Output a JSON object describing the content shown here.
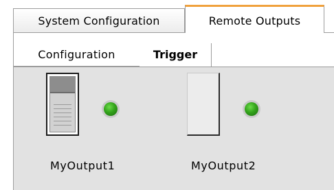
{
  "outer_tabs": [
    {
      "label": "System Configuration",
      "active": false
    },
    {
      "label": "Remote Outputs",
      "active": true
    }
  ],
  "inner_tabs": [
    {
      "label": "Configuration",
      "active": false
    },
    {
      "label": "Trigger",
      "active": true
    }
  ],
  "outputs": [
    {
      "label": "MyOutput1",
      "toggle_state": "on",
      "indicator_color": "#33a31b"
    },
    {
      "label": "MyOutput2",
      "toggle_state": "off",
      "indicator_color": "#33a31b"
    }
  ],
  "colors": {
    "active_tab_accent": "#f0a13c",
    "panel_background": "#e2e2e2",
    "led_green": "#33a31b"
  },
  "icons": {
    "output1_toggle": "toggle-switch-icon",
    "output2_toggle": "toggle-switch-icon",
    "output1_led": "status-led-icon",
    "output2_led": "status-led-icon"
  }
}
